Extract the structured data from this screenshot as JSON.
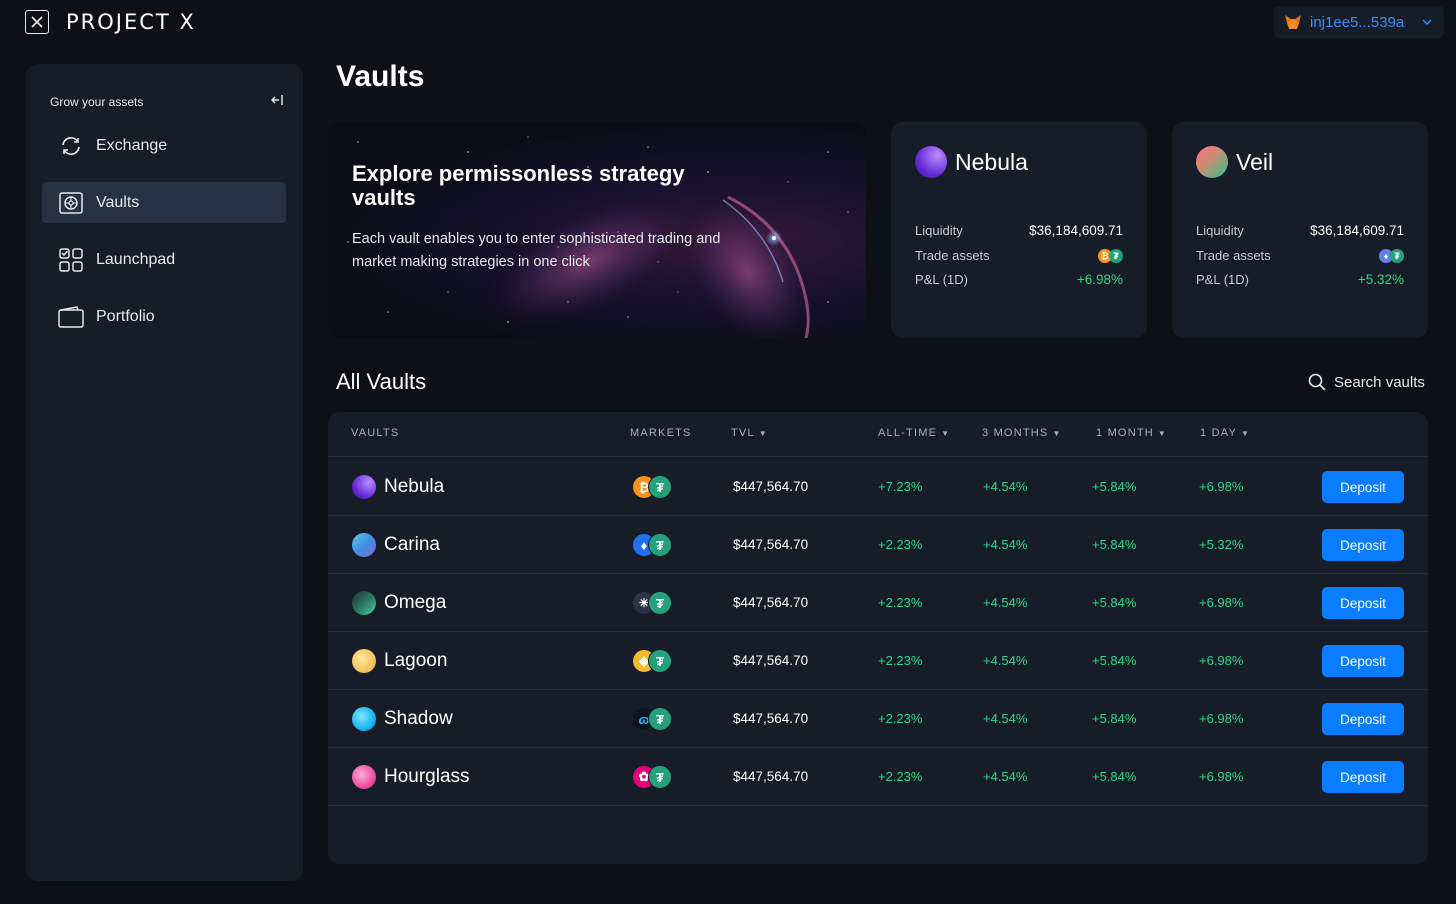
{
  "app": {
    "brand": "PROJECT X",
    "wallet_address": "inj1ee5...539a"
  },
  "sidebar": {
    "heading": "Grow your assets",
    "items": [
      {
        "label": "Exchange",
        "icon": "exchange-icon",
        "active": false
      },
      {
        "label": "Vaults",
        "icon": "vault-icon",
        "active": true
      },
      {
        "label": "Launchpad",
        "icon": "launchpad-icon",
        "active": false
      },
      {
        "label": "Portfolio",
        "icon": "wallet-icon",
        "active": false
      }
    ]
  },
  "main": {
    "title": "Vaults",
    "hero": {
      "title": "Explore permissonless strategy vaults",
      "description": "Each vault enables you to enter sophisticated trading and market making strategies in one click"
    },
    "featured": [
      {
        "name": "Nebula",
        "liquidity_label": "Liquidity",
        "liquidity": "$36,184,609.71",
        "trade_assets_label": "Trade assets",
        "assets": [
          "bitcoin",
          "tether"
        ],
        "pnl_label": "P&L (1D)",
        "pnl": "+6.98%"
      },
      {
        "name": "Veil",
        "liquidity_label": "Liquidity",
        "liquidity": "$36,184,609.71",
        "trade_assets_label": "Trade assets",
        "assets": [
          "ethereum",
          "tether"
        ],
        "pnl_label": "P&L (1D)",
        "pnl": "+5.32%"
      }
    ],
    "all_vaults": {
      "title": "All Vaults",
      "search_placeholder": "Search vaults",
      "columns": [
        "VAULTS",
        "MARKETS",
        "TVL",
        "ALL-TIME",
        "3 MONTHS",
        "1 MONTH",
        "1 DAY"
      ],
      "deposit_label": "Deposit",
      "rows": [
        {
          "name": "Nebula",
          "market": "bitcoin",
          "tvl": "$447,564.70",
          "all_time": "+7.23%",
          "m3": "+4.54%",
          "m1": "+5.84%",
          "d1": "+6.98%"
        },
        {
          "name": "Carina",
          "market": "ethereum",
          "tvl": "$447,564.70",
          "all_time": "+2.23%",
          "m3": "+4.54%",
          "m1": "+5.84%",
          "d1": "+5.32%"
        },
        {
          "name": "Omega",
          "market": "cosmos",
          "tvl": "$447,564.70",
          "all_time": "+2.23%",
          "m3": "+4.54%",
          "m1": "+5.84%",
          "d1": "+6.98%"
        },
        {
          "name": "Lagoon",
          "market": "binance",
          "tvl": "$447,564.70",
          "all_time": "+2.23%",
          "m3": "+4.54%",
          "m1": "+5.84%",
          "d1": "+6.98%"
        },
        {
          "name": "Shadow",
          "market": "injective",
          "tvl": "$447,564.70",
          "all_time": "+2.23%",
          "m3": "+4.54%",
          "m1": "+5.84%",
          "d1": "+6.98%"
        },
        {
          "name": "Hourglass",
          "market": "polkadot",
          "tvl": "$447,564.70",
          "all_time": "+2.23%",
          "m3": "+4.54%",
          "m1": "+5.84%",
          "d1": "+6.98%"
        }
      ]
    }
  },
  "colors": {
    "background": "#0d1117",
    "panel": "#161d29",
    "accent": "#0a7cff",
    "positive": "#2fd68b",
    "wallet_text": "#3d8df5"
  }
}
